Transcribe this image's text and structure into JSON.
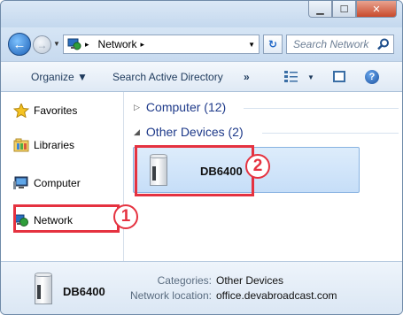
{
  "address": {
    "location": "Network",
    "search_placeholder": "Search Network"
  },
  "toolbar": {
    "organize": "Organize ▼",
    "search_ad": "Search Active Directory",
    "more": "»"
  },
  "sidebar": {
    "items": [
      {
        "label": "Favorites",
        "icon": "star-icon"
      },
      {
        "label": "Libraries",
        "icon": "libraries-folder-icon"
      },
      {
        "label": "Computer",
        "icon": "computer-icon"
      },
      {
        "label": "Network",
        "icon": "network-icon"
      }
    ]
  },
  "content": {
    "groups": [
      {
        "label": "Computer (12)",
        "expanded": false
      },
      {
        "label": "Other Devices (2)",
        "expanded": true
      }
    ],
    "device": {
      "name": "DB6400",
      "icon": "network-device-icon"
    }
  },
  "details": {
    "name": "DB6400",
    "categories_label": "Categories:",
    "categories_value": "Other Devices",
    "location_label": "Network location:",
    "location_value": "office.devabroadcast.com"
  },
  "callouts": {
    "one": "1",
    "two": "2"
  },
  "colors": {
    "highlight": "#e53240",
    "link": "#1e3a8a"
  }
}
